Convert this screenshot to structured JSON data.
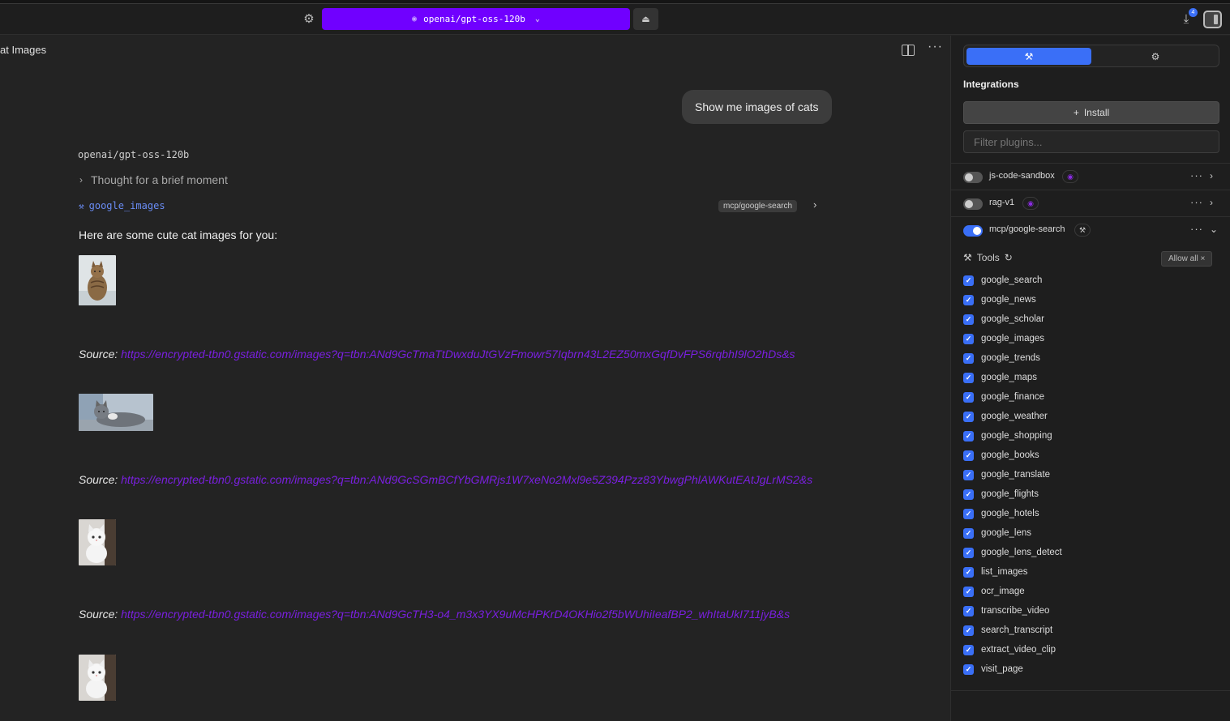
{
  "topbar": {
    "settings_icon": "gear-icon",
    "model_label": "openai/gpt-oss-120b",
    "model_icon": "eye-icon",
    "eject_icon": "eject-icon",
    "downloads_badge": "4",
    "accent": "#7000ff"
  },
  "chat": {
    "title": "at Images",
    "user_message": "Show me images of cats",
    "model_name": "openai/gpt-oss-120b",
    "thought": "Thought for a brief moment",
    "tool_name": "google_images",
    "tool_source": "mcp/google-search",
    "intro": "Here are some cute cat images for you:",
    "sources": [
      {
        "label": "Source:",
        "url": "https://encrypted-tbn0.gstatic.com/images?q=tbn:ANd9GcTmaTtDwxduJtGVzFmowr57Iqbrn43L2EZ50mxGqfDvFPS6rqbhI9lO2hDs&s"
      },
      {
        "label": "Source:",
        "url": "https://encrypted-tbn0.gstatic.com/images?q=tbn:ANd9GcSGmBCfYbGMRjs1W7xeNo2Mxl9e5Z394Pzz83YbwgPhlAWKutEAtJgLrMS2&s"
      },
      {
        "label": "Source:",
        "url": "https://encrypted-tbn0.gstatic.com/images?q=tbn:ANd9GcTH3-o4_m3x3YX9uMcHPKrD4OKHio2f5bWUhiIeafBP2_whItaUkI711jyB&s"
      }
    ],
    "link_color": "#7a1fe0"
  },
  "sidebar": {
    "heading": "Integrations",
    "install_label": "Install",
    "filter_placeholder": "Filter plugins...",
    "plugins": [
      {
        "name": "js-code-sandbox",
        "enabled": false
      },
      {
        "name": "rag-v1",
        "enabled": false
      },
      {
        "name": "mcp/google-search",
        "enabled": true
      }
    ],
    "tools_label": "Tools",
    "allow_all_label": "Allow all",
    "tools": [
      "google_search",
      "google_news",
      "google_scholar",
      "google_images",
      "google_trends",
      "google_maps",
      "google_finance",
      "google_weather",
      "google_shopping",
      "google_books",
      "google_translate",
      "google_flights",
      "google_hotels",
      "google_lens",
      "google_lens_detect",
      "list_images",
      "ocr_image",
      "transcribe_video",
      "search_transcript",
      "extract_video_clip",
      "visit_page"
    ],
    "toggle_on_color": "#3a6ff7"
  }
}
